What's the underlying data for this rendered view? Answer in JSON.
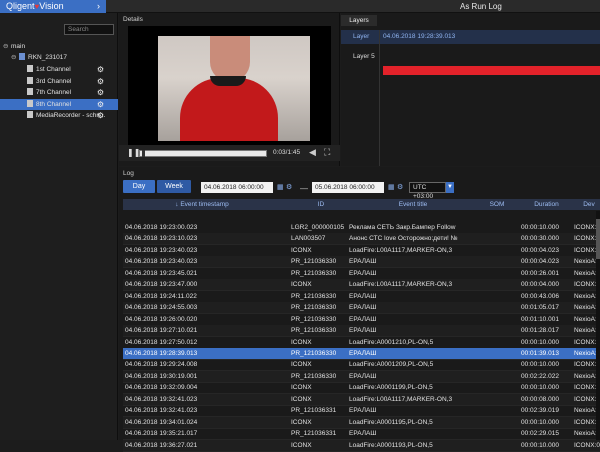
{
  "app": {
    "brand_name": "Qligent",
    "brand_product": "Vision",
    "title": "As Run Log"
  },
  "sidebar": {
    "search_placeholder": "Search",
    "items": [
      {
        "label": "main",
        "level": 0,
        "selected": false,
        "gear": false
      },
      {
        "label": "RKN_231017",
        "level": 1,
        "selected": false,
        "gear": false
      },
      {
        "label": "1st Channel",
        "level": 2,
        "selected": false,
        "gear": true
      },
      {
        "label": "3rd Channel",
        "level": 2,
        "selected": false,
        "gear": true
      },
      {
        "label": "7th Channel",
        "level": 2,
        "selected": false,
        "gear": true
      },
      {
        "label": "8th Channel",
        "level": 2,
        "selected": true,
        "gear": true
      },
      {
        "label": "MediaRecorder - schn...",
        "level": 2,
        "selected": false,
        "gear": true
      }
    ]
  },
  "details": {
    "label": "Details",
    "time": "0:03/1:45"
  },
  "layers": {
    "tab": "Layers",
    "header_label": "Layer",
    "header_time": "04.06.2018 19:28:39.013",
    "row_label": "Layer 5",
    "accent": "#e3222a"
  },
  "log": {
    "label": "Log",
    "day_button": "Day",
    "week_button": "Week",
    "from_date": "04.06.2018 06:00:00",
    "to_date": "05.06.2018 06:00:00",
    "timezone": "UTC +03:00",
    "columns": [
      "Event timestamp",
      "ID",
      "Event title",
      "SOM",
      "Duration",
      "Dev"
    ],
    "rows": [
      [
        "04.06.2018 19:23:00.023",
        "LGR2_000000105",
        "Реклама СЕТЬ Закр.Бампер Follow",
        "",
        "00:00:10.000",
        "ICONX:0"
      ],
      [
        "04.06.2018 19:23:10.023",
        "LAN003507",
        "Анонс СТС love Осторожно:дети! №",
        "",
        "00:00:30.000",
        "ICONX:4"
      ],
      [
        "04.06.2018 19:23:40.023",
        "ICONX",
        "LoadFire:L00A1117,MARKER-ON,3",
        "",
        "00:00:04.023",
        "ICONX:0"
      ],
      [
        "04.06.2018 19:23:40.023",
        "PR_121036330",
        "ЕРАЛАШ",
        "",
        "00:00:04.023",
        "NexioA:1"
      ],
      [
        "04.06.2018 19:23:45.021",
        "PR_121036330",
        "ЕРАЛАШ",
        "",
        "00:00:26.001",
        "NexioA:3"
      ],
      [
        "04.06.2018 19:23:47.000",
        "ICONX",
        "LoadFire:L00A1117,MARKER-ON,3",
        "",
        "00:00:04.000",
        "ICONX:0"
      ],
      [
        "04.06.2018 19:24:11.022",
        "PR_121036330",
        "ЕРАЛАШ",
        "",
        "00:00:43.006",
        "NexioA:2"
      ],
      [
        "04.06.2018 19:24:55.003",
        "PR_121036330",
        "ЕРАЛАШ",
        "",
        "00:01:05.017",
        "NexioA:1"
      ],
      [
        "04.06.2018 19:26:00.020",
        "PR_121036330",
        "ЕРАЛАШ",
        "",
        "00:01:10.001",
        "NexioA:3"
      ],
      [
        "04.06.2018 19:27:10.021",
        "PR_121036330",
        "ЕРАЛАШ",
        "",
        "00:01:28.017",
        "NexioA:2"
      ],
      [
        "04.06.2018 19:27:50.012",
        "ICONX",
        "LoadFire:A0001210,PL-ON,5",
        "",
        "00:00:10.000",
        "ICONX:0"
      ],
      [
        "04.06.2018 19:28:39.013",
        "PR_121036330",
        "ЕРАЛАШ",
        "",
        "00:01:39.013",
        "NexioA:2"
      ],
      [
        "04.06.2018 19:29:24.008",
        "ICONX",
        "LoadFire:A0001209,PL-ON,5",
        "",
        "00:00:10.000",
        "ICONX:0"
      ],
      [
        "04.06.2018 19:30:19.001",
        "PR_121036330",
        "ЕРАЛАШ",
        "",
        "00:02:22.022",
        "NexioA:4"
      ],
      [
        "04.06.2018 19:32:09.004",
        "ICONX",
        "LoadFire:A0001199,PL-ON,5",
        "",
        "00:00:10.000",
        "ICONX:0"
      ],
      [
        "04.06.2018 19:32:41.023",
        "ICONX",
        "LoadFire:L00A1117,MARKER-ON,3",
        "",
        "00:00:08.000",
        "ICONX:0"
      ],
      [
        "04.06.2018 19:32:41.023",
        "PR_121036331",
        "ЕРАЛАШ",
        "",
        "00:02:39.019",
        "NexioA:1"
      ],
      [
        "04.06.2018 19:34:01.024",
        "ICONX",
        "LoadFire:A0001195,PL-ON,5",
        "",
        "00:00:10.000",
        "ICONX:0"
      ],
      [
        "04.06.2018 19:35:21.017",
        "PR_121036331",
        "ЕРАЛАШ",
        "",
        "00:02:29.015",
        "NexioA:3"
      ],
      [
        "04.06.2018 19:36:27.021",
        "ICONX",
        "LoadFire:A0001193,PL-ON,5",
        "",
        "00:00:10.000",
        "ICONX:0"
      ]
    ],
    "selected_row": 11
  },
  "colors": {
    "accent": "#3b6fc4",
    "background": "#1c1c1c",
    "selected_row": "#3b6fc4"
  }
}
